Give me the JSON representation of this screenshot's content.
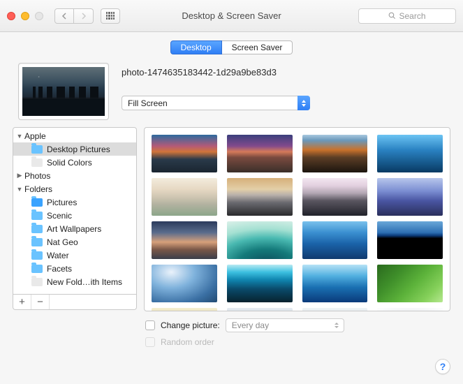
{
  "window": {
    "title": "Desktop & Screen Saver",
    "search_placeholder": "Search"
  },
  "tabs": {
    "desktop": "Desktop",
    "screensaver": "Screen Saver",
    "active": "desktop"
  },
  "current": {
    "filename": "photo-1474635183442-1d29a9be83d3",
    "fit_mode": "Fill Screen"
  },
  "sidebar": {
    "items": [
      {
        "label": "Apple",
        "depth": 1,
        "expanded": true,
        "hasFolder": false
      },
      {
        "label": "Desktop Pictures",
        "depth": 2,
        "selected": true
      },
      {
        "label": "Solid Colors",
        "depth": 2,
        "muted": true
      },
      {
        "label": "Photos",
        "depth": 1,
        "expanded": false,
        "hasFolder": false
      },
      {
        "label": "Folders",
        "depth": 1,
        "expanded": true,
        "hasFolder": false
      },
      {
        "label": "Pictures",
        "depth": 2,
        "camera": true
      },
      {
        "label": "Scenic",
        "depth": 2
      },
      {
        "label": "Art Wallpapers",
        "depth": 2
      },
      {
        "label": "Nat Geo",
        "depth": 2
      },
      {
        "label": "Water",
        "depth": 2
      },
      {
        "label": "Facets",
        "depth": 2
      },
      {
        "label": "New Fold…ith Items",
        "depth": 2,
        "muted": true
      }
    ]
  },
  "options": {
    "change_picture_label": "Change picture:",
    "change_interval": "Every day",
    "random_order_label": "Random order"
  },
  "help_glyph": "?"
}
